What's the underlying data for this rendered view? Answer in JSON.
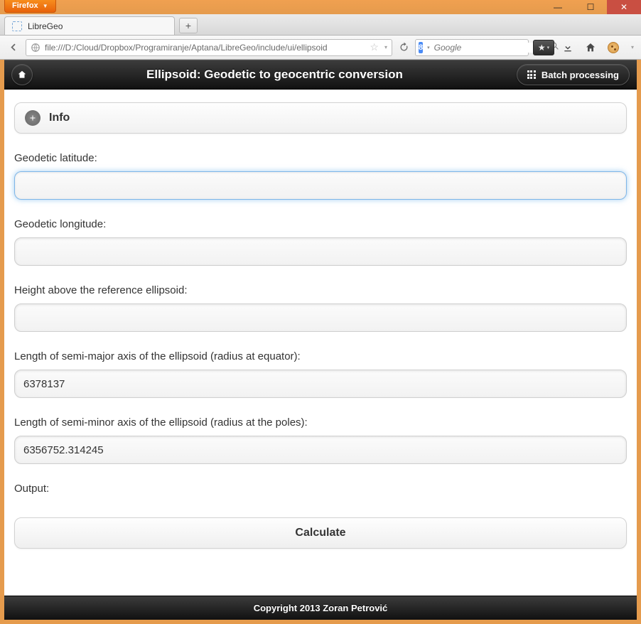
{
  "browser": {
    "name": "Firefox",
    "tab_title": "LibreGeo",
    "url": "file:///D:/Cloud/Dropbox/Programiranje/Aptana/LibreGeo/include/ui/ellipsoid",
    "search_placeholder": "Google"
  },
  "app": {
    "title": "Ellipsoid: Geodetic to geocentric conversion",
    "batch_button": "Batch processing",
    "info_header": "Info",
    "calculate_button": "Calculate",
    "footer": "Copyright 2013 Zoran Petrović"
  },
  "fields": [
    {
      "label": "Geodetic latitude:",
      "value": "",
      "focused": true
    },
    {
      "label": "Geodetic longitude:",
      "value": "",
      "focused": false
    },
    {
      "label": "Height above the reference ellipsoid:",
      "value": "",
      "focused": false
    },
    {
      "label": "Length of semi-major axis of the ellipsoid (radius at equator):",
      "value": "6378137",
      "focused": false
    },
    {
      "label": "Length of semi-minor axis of the ellipsoid (radius at the poles):",
      "value": "6356752.314245",
      "focused": false
    }
  ],
  "output_label": "Output:"
}
